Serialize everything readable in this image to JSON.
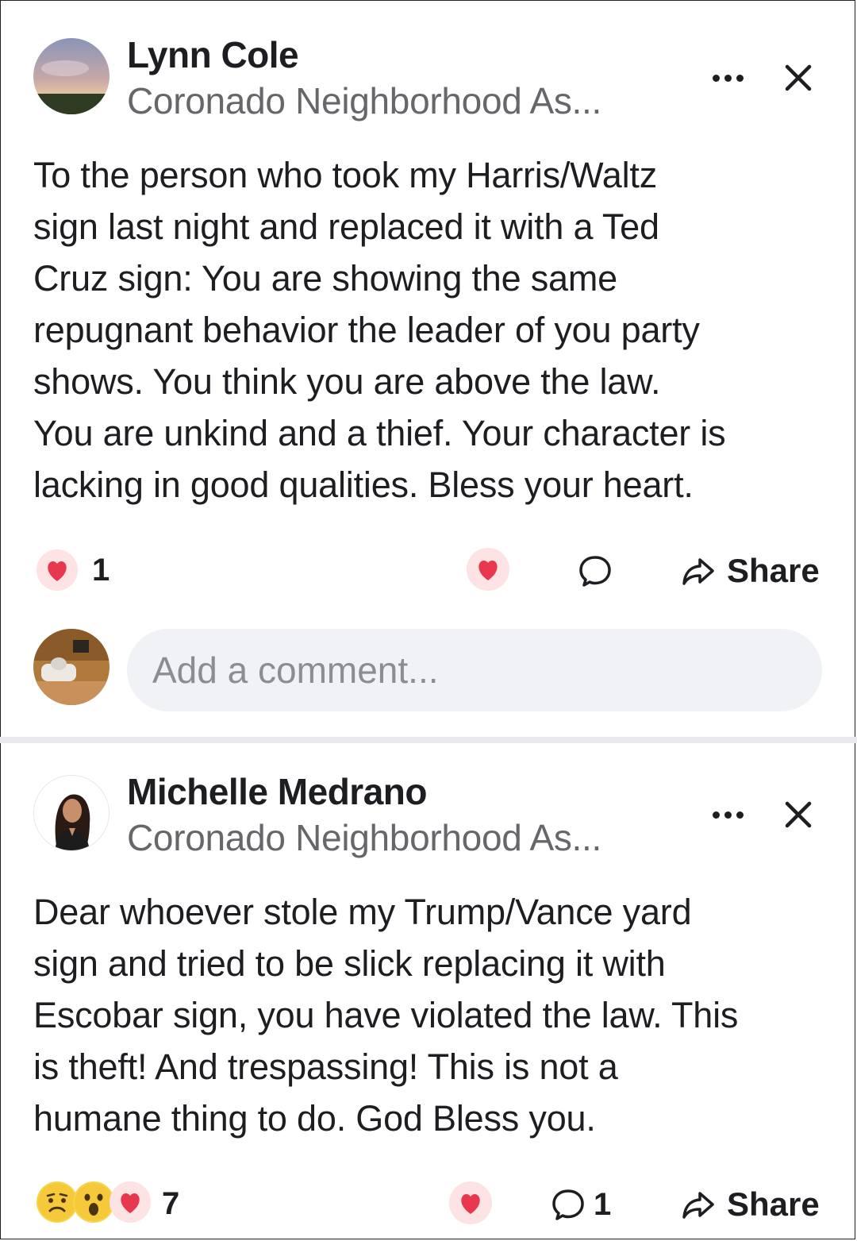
{
  "posts": [
    {
      "author": "Lynn Cole",
      "group": "Coronado Neighborhood As...",
      "text": "To the person who took my Harris/Waltz\nsign last night and replaced it with a Ted\nCruz sign:  You are showing the same\nrepugnant behavior the leader of you party\nshows.  You think you are above the law.\nYou are unkind and a thief. Your character is\nlacking in good qualities.  Bless your heart.",
      "reaction_count": "1",
      "reactions": [
        "heart"
      ],
      "share_label": "Share"
    },
    {
      "author": "Michelle Medrano",
      "group": "Coronado Neighborhood As...",
      "text": "Dear whoever stole my Trump/Vance yard\nsign and tried to be slick replacing it with\nEscobar sign, you have violated the law. This\nis theft! And trespassing! This is not a\nhumane thing to do. God Bless you.",
      "reaction_count": "7",
      "reactions": [
        "sad",
        "wow",
        "heart"
      ],
      "comment_count": "1",
      "share_label": "Share"
    }
  ],
  "comment_box": {
    "placeholder": "Add a comment..."
  },
  "colors": {
    "heart": "#f0284a",
    "secondary_text": "#65676b",
    "input_bg": "#f0f2f5"
  }
}
